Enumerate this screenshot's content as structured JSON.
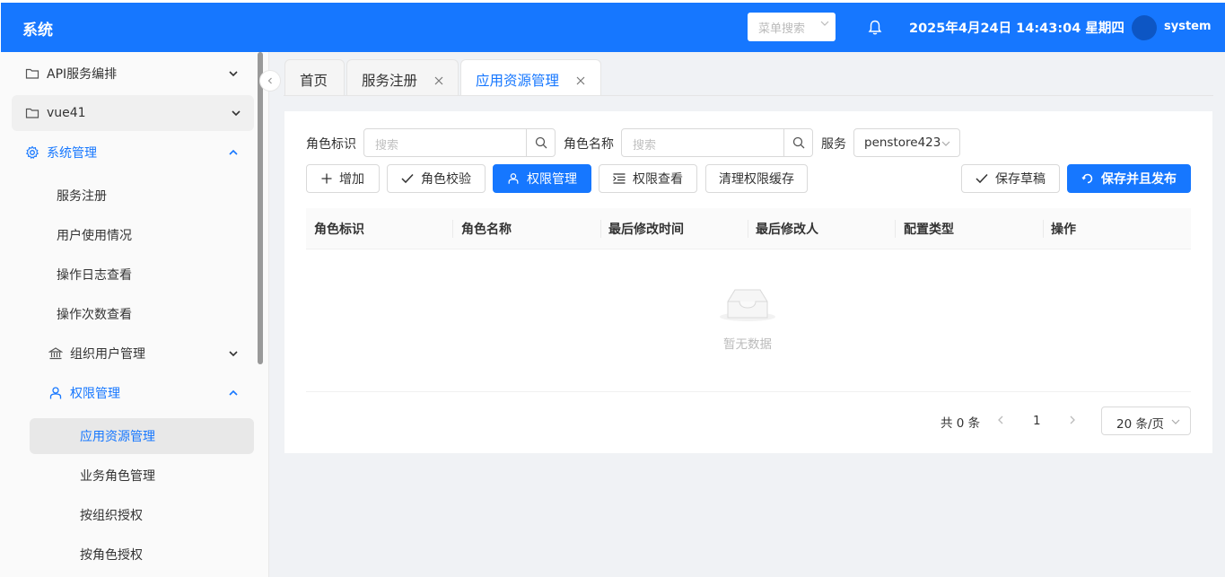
{
  "header": {
    "brand": "系统",
    "menu_search_placeholder": "菜单搜索",
    "datetime": "2025年4月24日 14:43:04 星期四",
    "username": "system"
  },
  "sidebar": {
    "items": [
      {
        "label": "API服务编排"
      },
      {
        "label": "vue41"
      },
      {
        "label": "系统管理"
      },
      {
        "label": "服务注册"
      },
      {
        "label": "用户使用情况"
      },
      {
        "label": "操作日志查看"
      },
      {
        "label": "操作次数查看"
      },
      {
        "label": "组织用户管理"
      },
      {
        "label": "权限管理"
      },
      {
        "label": "应用资源管理"
      },
      {
        "label": "业务角色管理"
      },
      {
        "label": "按组织授权"
      },
      {
        "label": "按角色授权"
      }
    ]
  },
  "tabs": [
    {
      "label": "首页"
    },
    {
      "label": "服务注册"
    },
    {
      "label": "应用资源管理"
    }
  ],
  "filters": {
    "role_id_label": "角色标识",
    "role_id_placeholder": "搜索",
    "role_name_label": "角色名称",
    "role_name_placeholder": "搜索",
    "service_label": "服务",
    "service_value": "penstore423"
  },
  "toolbar": {
    "add": "增加",
    "role_check": "角色校验",
    "perm_manage": "权限管理",
    "perm_view": "权限查看",
    "clear_cache": "清理权限缓存",
    "save_draft": "保存草稿",
    "save_publish": "保存并且发布"
  },
  "table": {
    "columns": [
      "角色标识",
      "角色名称",
      "最后修改时间",
      "最后修改人",
      "配置类型",
      "操作"
    ],
    "empty_text": "暂无数据"
  },
  "pagination": {
    "total": "共 0 条",
    "page": "1",
    "page_size": "20 条/页"
  },
  "colors": {
    "primary": "#1677ff",
    "header_bg": "#1677ff"
  }
}
